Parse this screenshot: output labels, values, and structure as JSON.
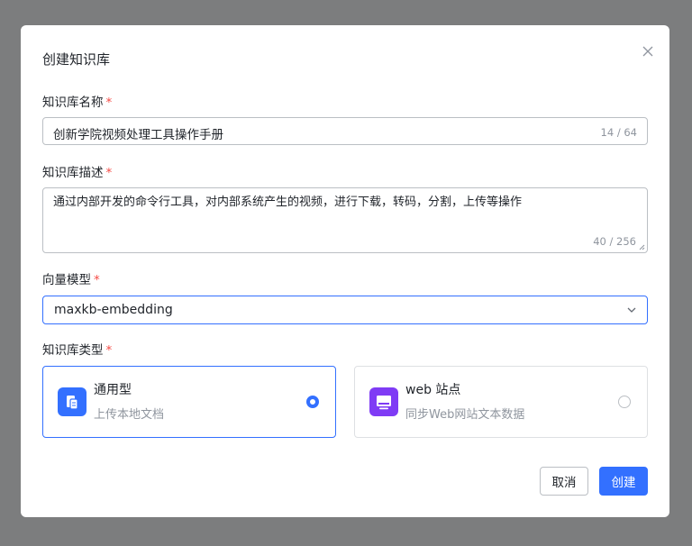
{
  "dialog": {
    "title": "创建知识库"
  },
  "form": {
    "name": {
      "label": "知识库名称",
      "required_mark": "*",
      "value": "创新学院视频处理工具操作手册",
      "counter": "14 / 64"
    },
    "description": {
      "label": "知识库描述",
      "required_mark": "*",
      "value": "通过内部开发的命令行工具，对内部系统产生的视频，进行下载，转码，分割，上传等操作",
      "counter": "40 / 256"
    },
    "model": {
      "label": "向量模型",
      "required_mark": "*",
      "selected": "maxkb-embedding"
    },
    "kb_type": {
      "label": "知识库类型",
      "required_mark": "*",
      "options": [
        {
          "title": "通用型",
          "subtitle": "上传本地文档",
          "icon": "document-icon",
          "icon_color": "#3370ff",
          "selected": true
        },
        {
          "title": "web 站点",
          "subtitle": "同步Web网站文本数据",
          "icon": "monitor-icon",
          "icon_color": "#7f3bf5",
          "selected": false
        }
      ]
    }
  },
  "footer": {
    "cancel_label": "取消",
    "create_label": "创建"
  },
  "colors": {
    "accent": "#3370ff",
    "required": "#f54a45",
    "overlay": "#7c7d7e"
  }
}
